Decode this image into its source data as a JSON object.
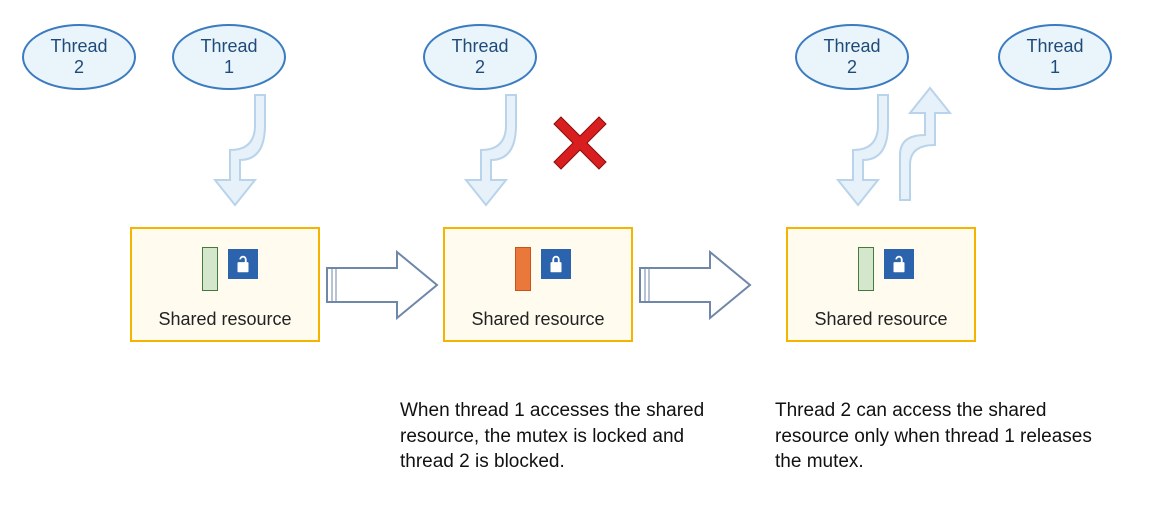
{
  "threads": {
    "t2": "Thread\n2",
    "t1": "Thread\n1"
  },
  "resource_label": "Shared resource",
  "captions": {
    "step2": "When thread 1 accesses the shared resource, the mutex is locked and thread 2 is blocked.",
    "step3": "Thread 2 can access the shared resource only when thread 1 releases the mutex."
  },
  "icons": {
    "unlock": "unlock-icon",
    "lock": "lock-icon",
    "blocked": "red-x"
  },
  "states": {
    "step1": "unlocked",
    "step2": "locked",
    "step3": "unlocked"
  }
}
